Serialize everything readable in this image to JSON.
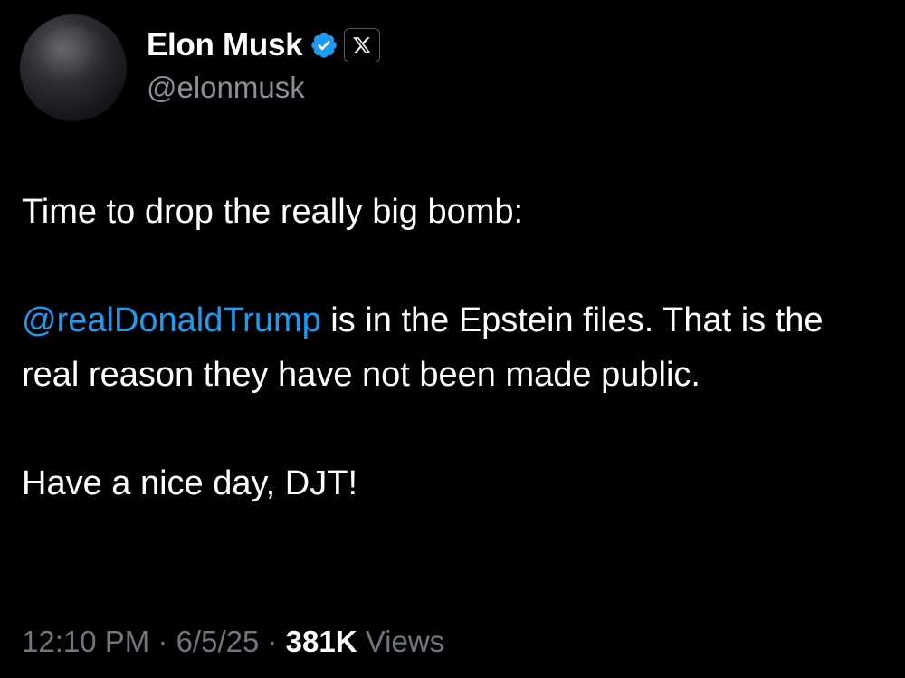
{
  "author": {
    "name": "Elon Musk",
    "handle": "@elonmusk",
    "verified_icon": "verified-badge-icon",
    "affiliate_icon": "x-logo-icon"
  },
  "tweet": {
    "line1": "Time to drop the really big bomb:",
    "mention": "@realDonaldTrump",
    "line2_rest": " is in the Epstein files. That is the real reason they have not been made public.",
    "line3": "Have a nice day, DJT!"
  },
  "meta": {
    "time": "12:10 PM",
    "sep1": " · ",
    "date": "6/5/25",
    "sep2": " · ",
    "views_count": "381K",
    "views_label": " Views"
  },
  "colors": {
    "background": "#000000",
    "mention": "#1d9bf0",
    "verified": "#1d9bf0",
    "meta_text": "#71767b"
  }
}
